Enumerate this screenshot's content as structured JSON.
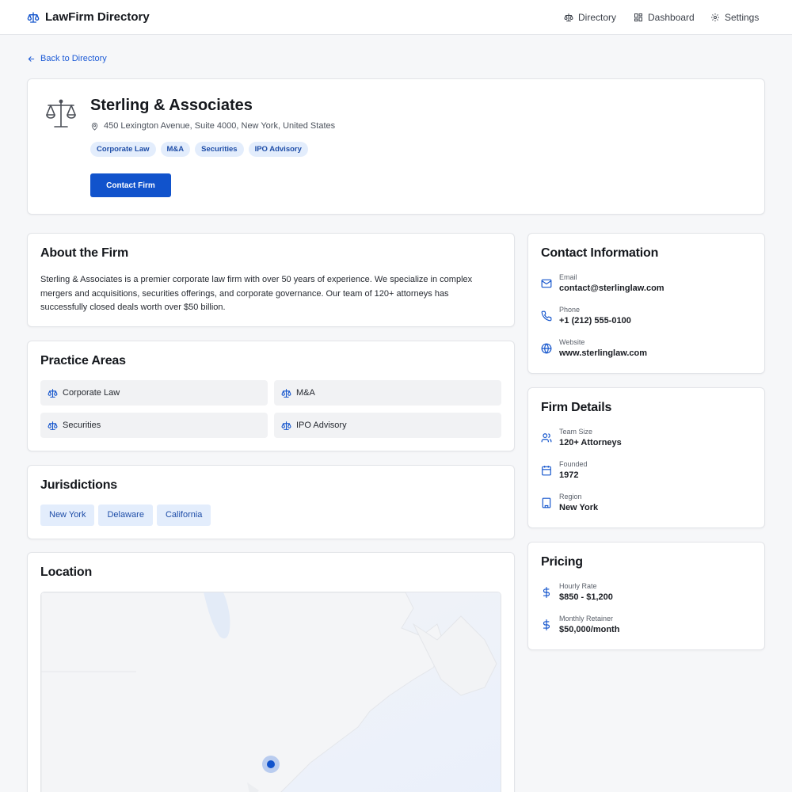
{
  "app": {
    "name": "LawFirm Directory",
    "nav": [
      "Directory",
      "Dashboard",
      "Settings"
    ],
    "back_label": "Back to Directory",
    "accent": "#1153cc"
  },
  "firm": {
    "name": "Sterling & Associates",
    "address": "450 Lexington Avenue, Suite 4000, New York, United States",
    "tags": [
      "Corporate Law",
      "M&A",
      "Securities",
      "IPO Advisory"
    ],
    "contact_button": "Contact Firm"
  },
  "about": {
    "title": "About the Firm",
    "text": "Sterling & Associates is a premier corporate law firm with over 50 years of experience. We specialize in complex mergers and acquisitions, securities offerings, and corporate governance. Our team of 120+ attorneys has successfully closed deals worth over $50 billion."
  },
  "practice": {
    "title": "Practice Areas",
    "items": [
      "Corporate Law",
      "M&A",
      "Securities",
      "IPO Advisory"
    ]
  },
  "jurisdictions": {
    "title": "Jurisdictions",
    "items": [
      "New York",
      "Delaware",
      "California"
    ]
  },
  "location": {
    "title": "Location"
  },
  "contact": {
    "title": "Contact Information",
    "rows": [
      {
        "label": "Email",
        "value": "contact@sterlinglaw.com",
        "icon": "mail-icon"
      },
      {
        "label": "Phone",
        "value": "+1 (212) 555-0100",
        "icon": "phone-icon"
      },
      {
        "label": "Website",
        "value": "www.sterlinglaw.com",
        "icon": "globe-icon"
      }
    ]
  },
  "details": {
    "title": "Firm Details",
    "rows": [
      {
        "label": "Team Size",
        "value": "120+ Attorneys",
        "icon": "users-icon"
      },
      {
        "label": "Founded",
        "value": "1972",
        "icon": "calendar-icon"
      },
      {
        "label": "Region",
        "value": "New York",
        "icon": "building-icon"
      }
    ]
  },
  "pricing": {
    "title": "Pricing",
    "rows": [
      {
        "label": "Hourly Rate",
        "value": "$850 - $1,200",
        "icon": "dollar-icon"
      },
      {
        "label": "Monthly Retainer",
        "value": "$50,000/month",
        "icon": "dollar-icon"
      }
    ]
  }
}
